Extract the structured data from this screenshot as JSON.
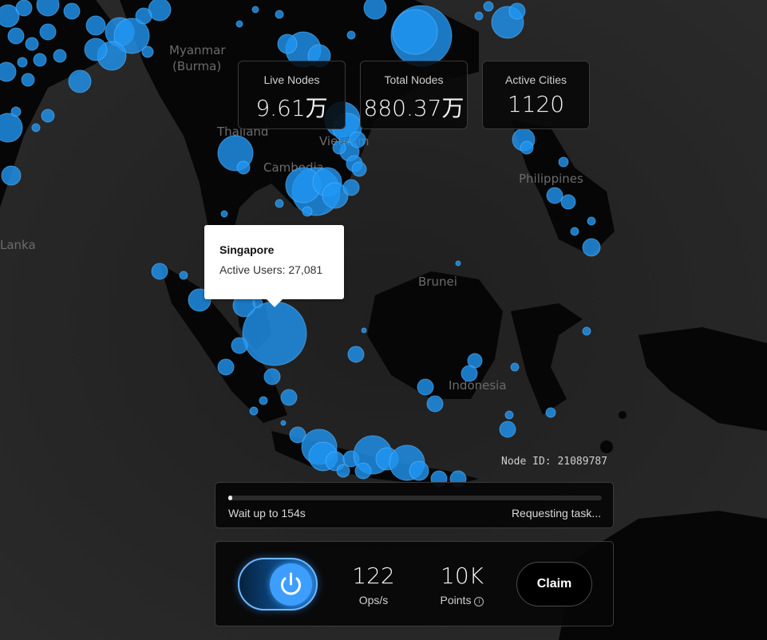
{
  "map": {
    "labels": [
      "Myanmar",
      "(Burma)",
      "Thailand",
      "Vietnam",
      "Cambodia",
      "Philippines",
      "Brunei",
      "Indonesia",
      "Lanka"
    ],
    "bubble_color": "#2196f3"
  },
  "stats": [
    {
      "label": "Live Nodes",
      "value": "9.61万"
    },
    {
      "label": "Total Nodes",
      "value": "880.37万"
    },
    {
      "label": "Active Cities",
      "value": "1120"
    }
  ],
  "tooltip": {
    "city": "Singapore",
    "users": "Active Users: 27,081"
  },
  "node_id": "Node ID: 21089787",
  "task": {
    "progress": 0.01,
    "wait_text": "Wait up to 154s",
    "status_text": "Requesting task..."
  },
  "controls": {
    "power_icon": "power-icon",
    "power_state": "on",
    "ops_value": "122",
    "ops_label": "Ops/s",
    "points_value": "10K",
    "points_label": "Points",
    "info_icon": "info-icon",
    "claim_label": "Claim"
  },
  "colors": {
    "accent": "#3d9eff",
    "background": "#141414"
  }
}
